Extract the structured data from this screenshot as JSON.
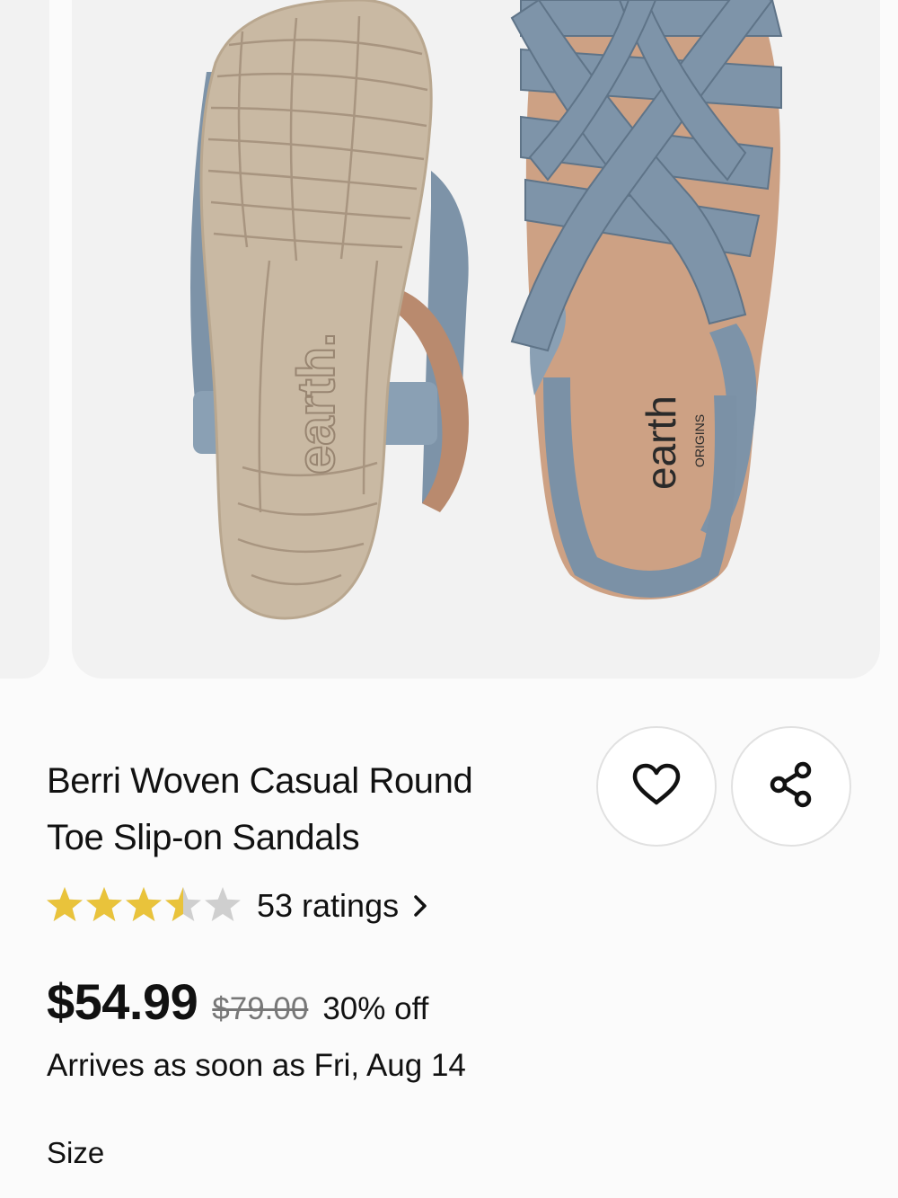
{
  "product": {
    "title_line1": "Berri Woven Casual Round",
    "title_line2": "Toe Slip-on Sandals",
    "rating": 3.5,
    "max_rating": 5,
    "ratings_label": "53 ratings",
    "price": "$54.99",
    "original_price": "$79.00",
    "discount": "30% off",
    "delivery": "Arrives as soon as Fri, Aug 14",
    "size_label": "Size"
  },
  "image": {
    "sole_brand": "earth.",
    "insole_brand": "earth",
    "insole_sub": "ORIGINS"
  },
  "icons": {
    "favorite": "heart-icon",
    "share": "share-icon",
    "ratings_chevron": "chevron-right-icon"
  },
  "colors": {
    "star_filled": "#e9c33b",
    "star_empty": "#cfcfcf",
    "leather": "#7b91a6",
    "sole": "#c7b7a1",
    "footbed": "#cc9f82"
  }
}
